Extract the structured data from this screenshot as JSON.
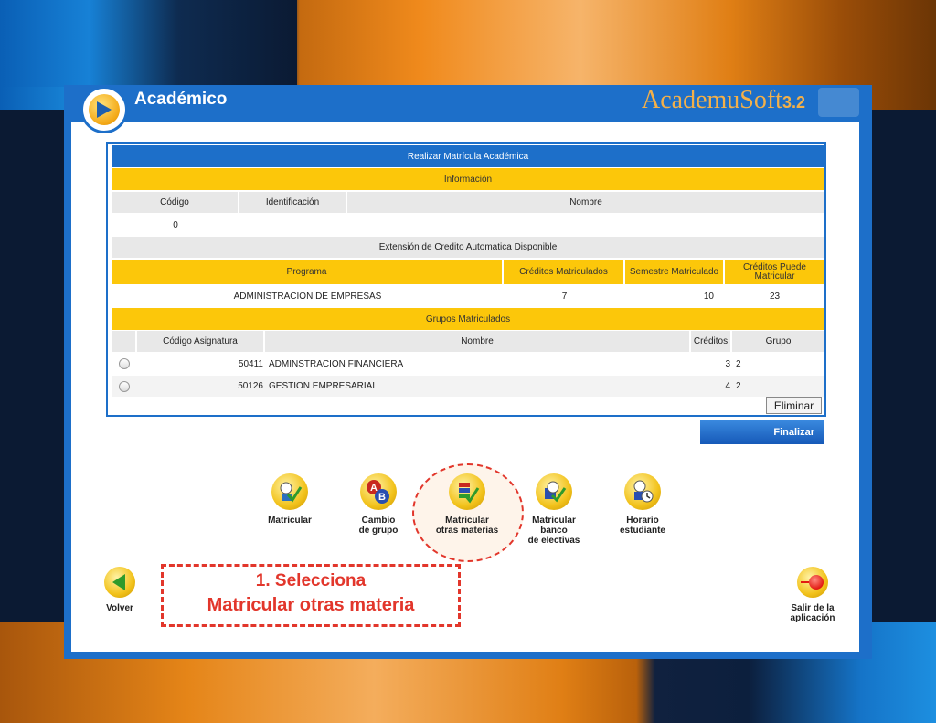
{
  "app": {
    "module_title": "Académico",
    "brand_name": "AcademuSoft",
    "brand_version": "3.2"
  },
  "panel": {
    "title": "Realizar Matrícula Académica",
    "info_header": "Información",
    "info_columns": [
      "Código",
      "Identificación",
      "Nombre"
    ],
    "info_values": {
      "codigo": "0",
      "identificacion": "",
      "nombre": ""
    },
    "credit_extension": "Extensión de Credito Automatica Disponible",
    "program_columns": [
      "Programa",
      "Créditos Matriculados",
      "Semestre Matriculado",
      "Créditos Puede Matricular"
    ],
    "program_row": {
      "programa": "ADMINISTRACION DE EMPRESAS",
      "creditos_matriculados": "7",
      "semestre": "10",
      "creditos_puede": "23"
    },
    "groups_header": "Grupos Matriculados",
    "group_columns": [
      "Código Asignatura",
      "Nombre",
      "Créditos",
      "Grupo"
    ],
    "groups": [
      {
        "codigo": "50411",
        "nombre": "ADMINSTRACION FINANCIERA",
        "creditos": "3",
        "grupo": "2"
      },
      {
        "codigo": "50126",
        "nombre": "GESTION EMPRESARIAL",
        "creditos": "4",
        "grupo": "2"
      }
    ],
    "delete_button": "Eliminar"
  },
  "finish_button": "Finalizar",
  "toolbar": [
    {
      "label_1": "Matricular",
      "label_2": "",
      "label_3": "",
      "icon": "enroll-check-icon"
    },
    {
      "label_1": "Cambio",
      "label_2": "de grupo",
      "label_3": "",
      "icon": "change-group-ab-icon"
    },
    {
      "label_1": "Matricular",
      "label_2": "otras materias",
      "label_3": "",
      "icon": "enroll-other-subjects-icon"
    },
    {
      "label_1": "Matricular",
      "label_2": "banco",
      "label_3": "de electivas",
      "icon": "electives-bank-icon"
    },
    {
      "label_1": "Horario",
      "label_2": "estudiante",
      "label_3": "",
      "icon": "student-schedule-icon"
    }
  ],
  "nav": {
    "back_label": "Volver",
    "exit_label_1": "Salir de la",
    "exit_label_2": "aplicación"
  },
  "callout": {
    "line1": "1. Selecciona",
    "line2": "Matricular otras materia"
  },
  "colors": {
    "header_blue": "#1d6fc9",
    "row_yellow": "#fcc70a",
    "annotation_red": "#e2362b",
    "brand_orange": "#f3b04a"
  }
}
